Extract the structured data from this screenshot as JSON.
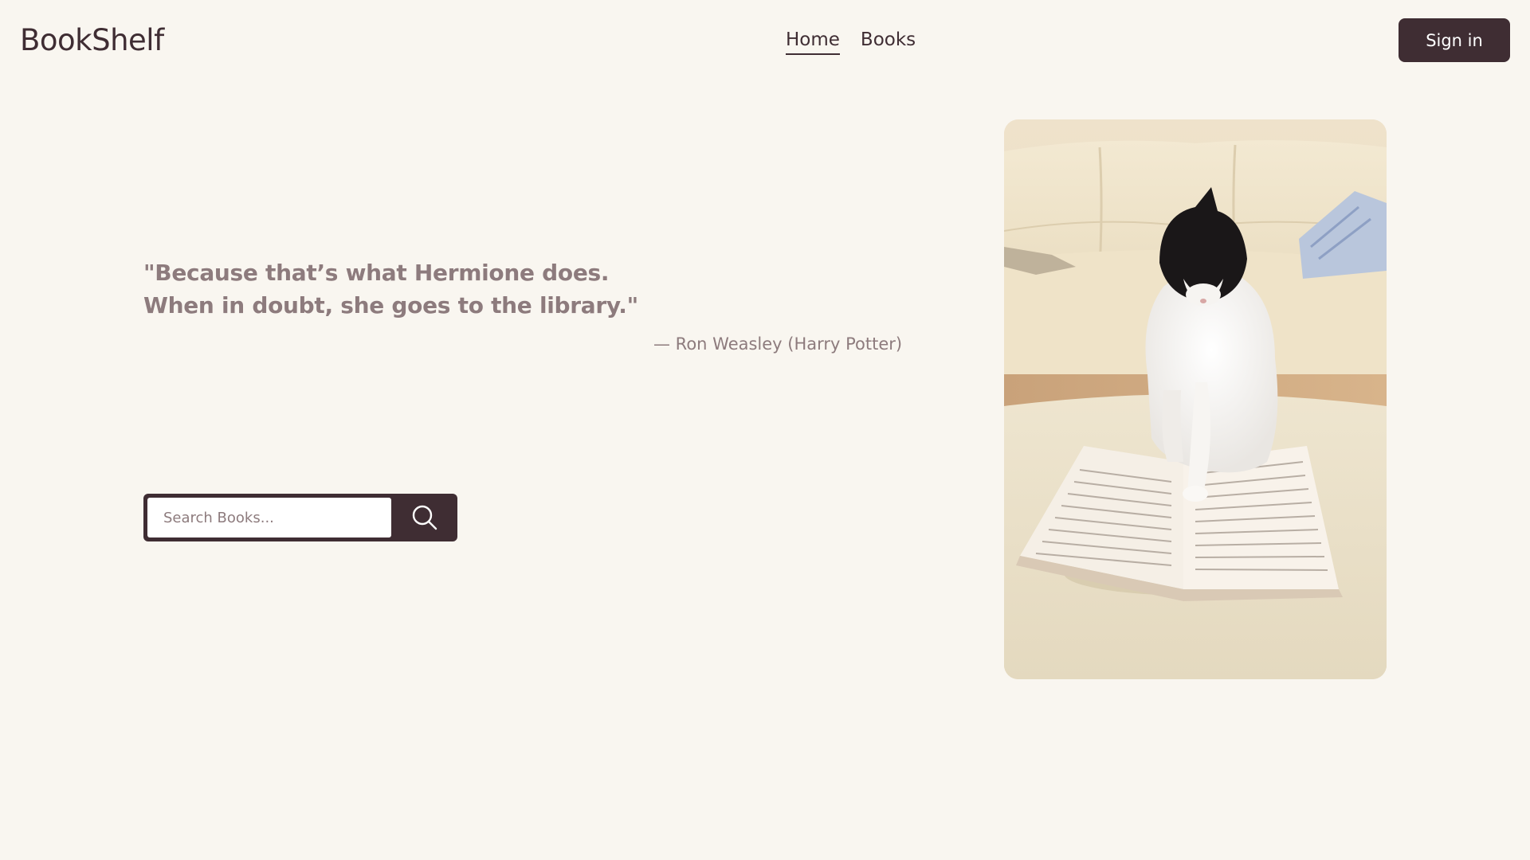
{
  "header": {
    "logo": "BookShelf",
    "nav": [
      {
        "label": "Home",
        "active": true
      },
      {
        "label": "Books",
        "active": false
      }
    ],
    "signin_label": "Sign in"
  },
  "hero": {
    "quote_line1": "\"Because that’s what Hermione does.",
    "quote_line2": "When in doubt, she goes to the library.\"",
    "attribution": "— Ron Weasley (Harry Potter)"
  },
  "search": {
    "placeholder": "Search Books...",
    "value": "",
    "button_icon": "search-icon"
  },
  "image": {
    "alt": "cat-reading-book-photo"
  },
  "colors": {
    "background": "#f9f6f0",
    "primary": "#3f2d33",
    "muted_text": "#8d7b7d",
    "white": "#ffffff"
  }
}
